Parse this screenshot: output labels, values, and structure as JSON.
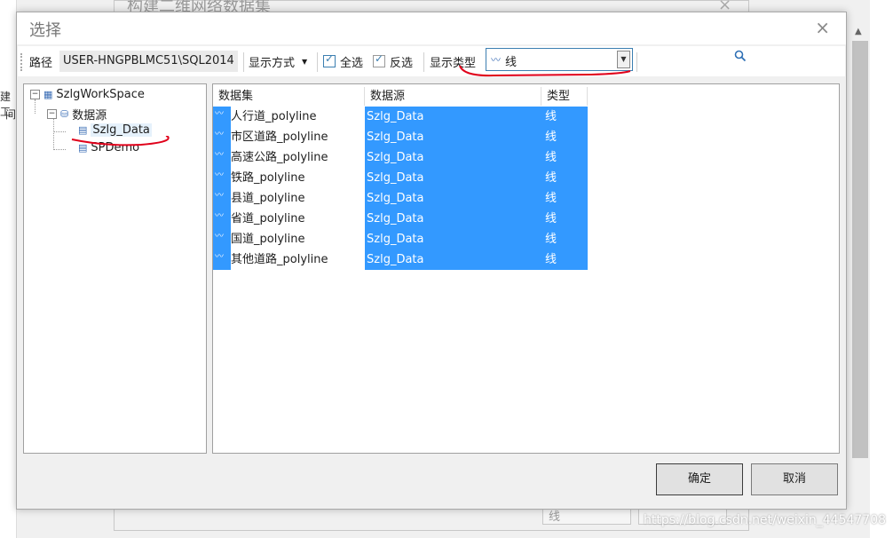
{
  "background": {
    "window_title": "构建二维网络数据集",
    "left_fragment": [
      "建工",
      "间"
    ],
    "buttons": [
      "线",
      ""
    ]
  },
  "dialog": {
    "title": "选择",
    "close_symbol": "×",
    "toolbar": {
      "path_label": "路径",
      "path_value": "USER-HNGPBLMC51\\SQL2014",
      "display_mode_label": "显示方式",
      "select_all_label": "全选",
      "invert_label": "反选",
      "display_type_label": "显示类型",
      "display_type_value": "线"
    },
    "tree": {
      "root": "SzlgWorkSpace",
      "datasources_label": "数据源",
      "items": [
        "Szlg_Data",
        "SPDemo"
      ]
    },
    "grid": {
      "headers": [
        "数据集",
        "数据源",
        "类型"
      ],
      "rows": [
        {
          "dataset": "人行道_polyline",
          "source": "Szlg_Data",
          "type": "线"
        },
        {
          "dataset": "市区道路_polyline",
          "source": "Szlg_Data",
          "type": "线"
        },
        {
          "dataset": "高速公路_polyline",
          "source": "Szlg_Data",
          "type": "线"
        },
        {
          "dataset": "铁路_polyline",
          "source": "Szlg_Data",
          "type": "线"
        },
        {
          "dataset": "县道_polyline",
          "source": "Szlg_Data",
          "type": "线"
        },
        {
          "dataset": "省道_polyline",
          "source": "Szlg_Data",
          "type": "线"
        },
        {
          "dataset": "国道_polyline",
          "source": "Szlg_Data",
          "type": "线"
        },
        {
          "dataset": "其他道路_polyline",
          "source": "Szlg_Data",
          "type": "线"
        }
      ]
    },
    "ok_label": "确定",
    "cancel_label": "取消"
  },
  "watermark": "https://blog.csdn.net/weixin_44547708",
  "colors": {
    "selection": "#3399ff",
    "annotation": "#e0001a"
  }
}
